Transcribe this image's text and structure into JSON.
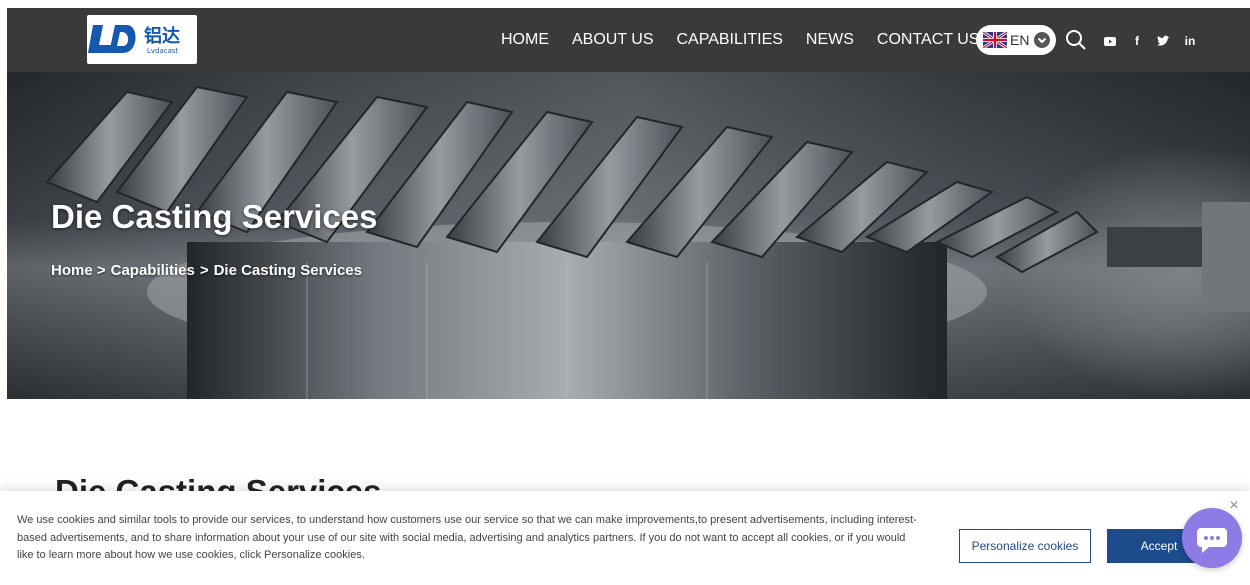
{
  "header": {
    "logo_text": "铝达",
    "logo_sub": "Lvdacast",
    "nav": [
      "HOME",
      "ABOUT US",
      "CAPABILITIES",
      "NEWS",
      "CONTACT US"
    ],
    "language": "EN",
    "icons": [
      "search-icon",
      "youtube-icon",
      "facebook-icon",
      "twitter-icon",
      "linkedin-icon"
    ]
  },
  "hero": {
    "title": "Die Casting Services",
    "breadcrumb": [
      "Home >",
      "Capabilities",
      ">",
      "Die Casting Services"
    ]
  },
  "section": {
    "title": "Die Casting Services"
  },
  "cookie": {
    "text": "We use cookies and similar tools to provide our services, to understand how customers use our service so that we can make improvements,to present advertisements, including interest-based advertisements, and to share information about your use of our site with social media, advertising and analytics partners. If you do not want to accept all cookies, or if you would like to learn more about how we use cookies, click Personalize cookies.",
    "personalize_label": "Personalize cookies",
    "accept_label": "Accept"
  },
  "colors": {
    "header_bg": "#3a3a3a",
    "brand_blue": "#1e4b8c",
    "chat_purple": "#8e7be6"
  }
}
